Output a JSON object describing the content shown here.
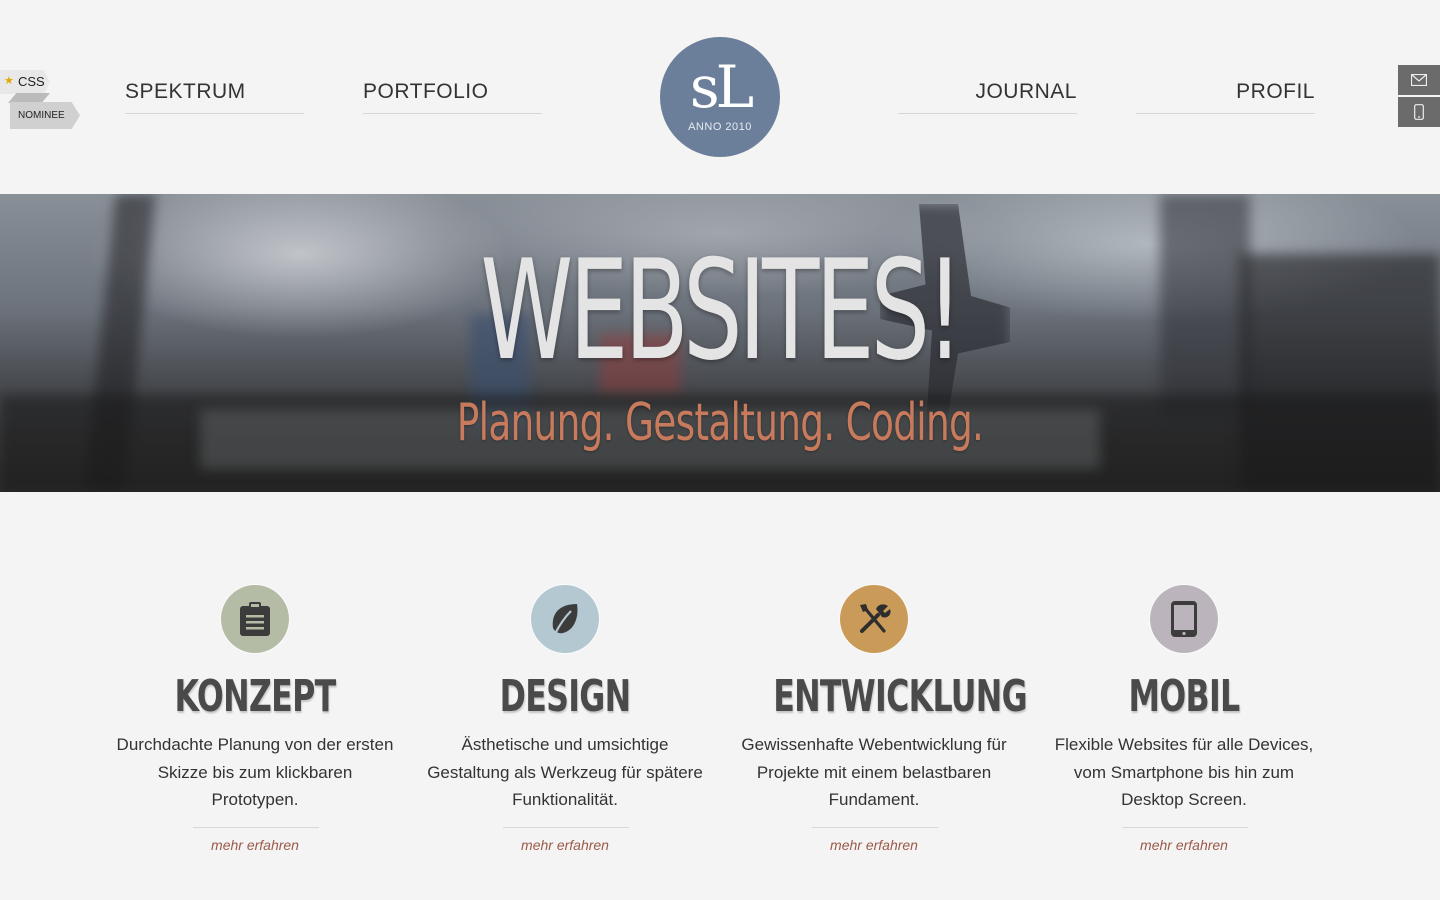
{
  "badge": {
    "line1": "CSS",
    "line2": "NOMINEE"
  },
  "nav": {
    "left": [
      "SPEKTRUM",
      "PORTFOLIO"
    ],
    "right": [
      "JOURNAL",
      "PROFIL"
    ]
  },
  "logo": {
    "mark": "sL",
    "subtitle": "ANNO 2010",
    "color": "#6c7f9a"
  },
  "side_tools": {
    "icons": [
      "mail-icon",
      "phone-icon"
    ]
  },
  "hero": {
    "title": "WEBSITES!",
    "subtitle": "Planung. Gestaltung. Coding.",
    "title_color": "#e4e4e4",
    "subtitle_color": "#c87a5c"
  },
  "features": [
    {
      "icon": "clipboard-icon",
      "icon_bg": "#b4bca6",
      "title": "KONZEPT",
      "text": "Durchdachte Planung von der ersten Skizze bis zum klickbaren Prototypen.",
      "link": "mehr erfahren"
    },
    {
      "icon": "leaf-icon",
      "icon_bg": "#b4c8d2",
      "title": "DESIGN",
      "text": "Ästhetische und umsichtige Gestaltung als Werkzeug für spätere Funktionalität.",
      "link": "mehr erfahren"
    },
    {
      "icon": "tools-icon",
      "icon_bg": "#c99a58",
      "title": "ENTWICKLUNG",
      "text": "Gewissenhafte Webentwicklung für Projekte mit einem belastbaren Fundament.",
      "link": "mehr erfahren"
    },
    {
      "icon": "tablet-icon",
      "icon_bg": "#bcb4bc",
      "title": "MOBIL",
      "text": "Flexible Websites für alle Devices, vom Smartphone bis hin zum Desktop Screen.",
      "link": "mehr erfahren"
    }
  ]
}
